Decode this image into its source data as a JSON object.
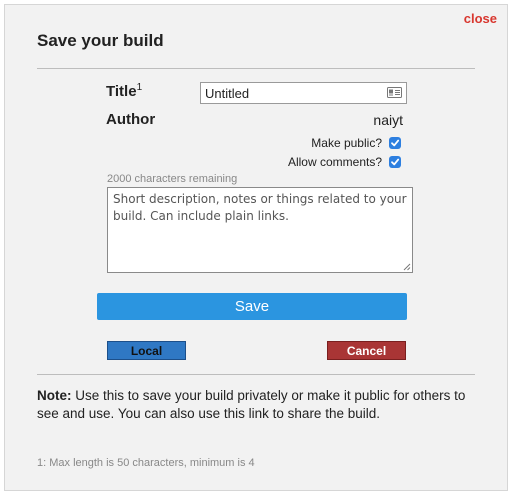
{
  "dialog": {
    "title": "Save your build",
    "close_label": "close"
  },
  "form": {
    "title_label": "Title",
    "title_footnote_marker": "1",
    "title_value": "Untitled",
    "author_label": "Author",
    "author_value": "naiyt",
    "make_public_label": "Make public?",
    "make_public_checked": true,
    "allow_comments_label": "Allow comments?",
    "allow_comments_checked": true,
    "chars_remaining": "2000 characters remaining",
    "description_placeholder": "Short description, notes or things related to your build. Can include plain links."
  },
  "buttons": {
    "save_label": "Save",
    "local_label": "Local",
    "cancel_label": "Cancel"
  },
  "note": {
    "prefix": "Note:",
    "text": "Use this to save your build privately or make it public for others to see and use. You can also use this link to share the build."
  },
  "footnote": "1: Max length is 50 characters, minimum is 4",
  "colors": {
    "close": "#d8372f",
    "save_button": "#2b95e0",
    "local_button": "#2f78c4",
    "cancel_button": "#a93535",
    "checkbox": "#2d7fe0"
  }
}
